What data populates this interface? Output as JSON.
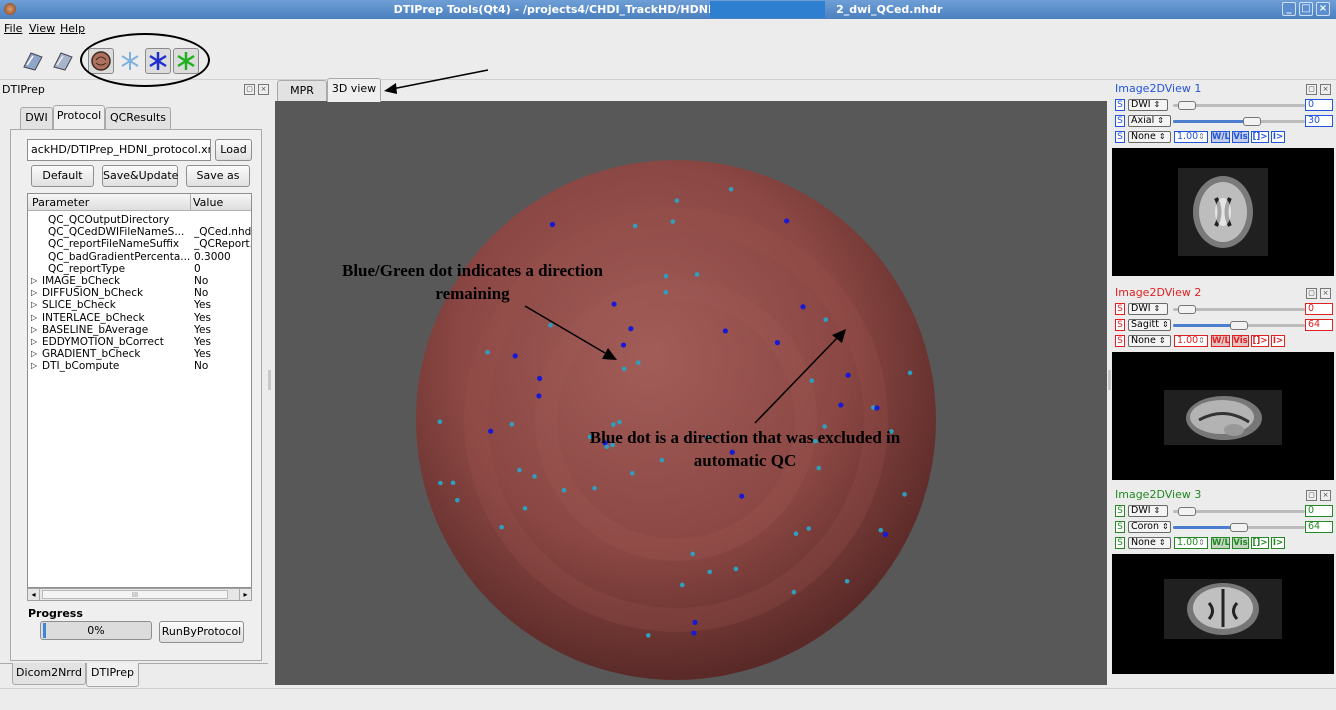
{
  "window": {
    "title": "DTIPrep Tools(Qt4) - /projects4/CHDI_TrackHD/HDNI/",
    "title_suffix": "2_dwi_QCed.nhdr",
    "minimize": "_",
    "maximize": "□",
    "close": "×"
  },
  "menu": [
    "File",
    "View",
    "Help"
  ],
  "toolbar_icons": [
    "open-dwi-icon",
    "save-dwi-icon",
    "brain-icon",
    "gradient-sphere-icon",
    "gradient-blue-icon",
    "gradient-green-icon"
  ],
  "left_panel": {
    "title": "DTIPrep",
    "tabs": [
      "DWI",
      "Protocol",
      "QCResults"
    ],
    "protocol_path": "ackHD/DTIPrep_HDNI_protocol.xml",
    "load": "Load",
    "default": "Default",
    "save_update": "Save&Update",
    "save_as": "Save as",
    "columns": [
      "Parameter",
      "Value"
    ],
    "rows": [
      {
        "param": "QC_QCOutputDirectory",
        "value": "",
        "expand": false
      },
      {
        "param": "QC_QCedDWIFileNameS...",
        "value": "_QCed.nhd",
        "expand": false
      },
      {
        "param": "QC_reportFileNameSuffix",
        "value": "_QCReport.",
        "expand": false
      },
      {
        "param": "QC_badGradientPercenta...",
        "value": "0.3000",
        "expand": false
      },
      {
        "param": "QC_reportType",
        "value": "0",
        "expand": false
      },
      {
        "param": "IMAGE_bCheck",
        "value": "No",
        "expand": true
      },
      {
        "param": "DIFFUSION_bCheck",
        "value": "No",
        "expand": true
      },
      {
        "param": "SLICE_bCheck",
        "value": "Yes",
        "expand": true
      },
      {
        "param": "INTERLACE_bCheck",
        "value": "Yes",
        "expand": true
      },
      {
        "param": "BASELINE_bAverage",
        "value": "Yes",
        "expand": true
      },
      {
        "param": "EDDYMOTION_bCorrect",
        "value": "Yes",
        "expand": true
      },
      {
        "param": "GRADIENT_bCheck",
        "value": "Yes",
        "expand": true
      },
      {
        "param": "DTI_bCompute",
        "value": "No",
        "expand": true
      }
    ],
    "scroll_glyph": "III",
    "scroll_left": "◂",
    "scroll_right": "▸",
    "expand_glyph": "▷",
    "progress_label": "Progress",
    "progress_percent": "0%",
    "progress_value": 0,
    "run": "RunByProtocol",
    "bottom_tabs": [
      "Dicom2Nrrd",
      "DTIPrep"
    ]
  },
  "center": {
    "tabs": [
      "MPR",
      "3D view"
    ],
    "annotation1": "Blue/Green dot indicates a direction remaining",
    "annotation2": "Blue dot is a direction that was excluded in automatic QC"
  },
  "views": [
    {
      "title": "Image2DView 1",
      "color": "#2255dd",
      "image": "DWI",
      "orient": "Axial",
      "lut": "None",
      "wl": "1.00",
      "img_num": "0",
      "slice_num": "30",
      "slider2": 0.6
    },
    {
      "title": "Image2DView 2",
      "color": "#dd2222",
      "image": "DWI",
      "orient": "Sagitt",
      "lut": "None",
      "wl": "1.00",
      "img_num": "0",
      "slice_num": "64",
      "slider2": 0.5
    },
    {
      "title": "Image2DView 3",
      "color": "#228822",
      "image": "DWI",
      "orient": "Coron",
      "lut": "None",
      "wl": "1.00",
      "img_num": "0",
      "slice_num": "64",
      "slider2": 0.5
    }
  ],
  "view_buttons": {
    "s": "S",
    "wl": "W/L",
    "vis": "Vis",
    "range": "[]>",
    "play": "I>",
    "spin": "⇕",
    "combo_arrow": "⇕"
  }
}
